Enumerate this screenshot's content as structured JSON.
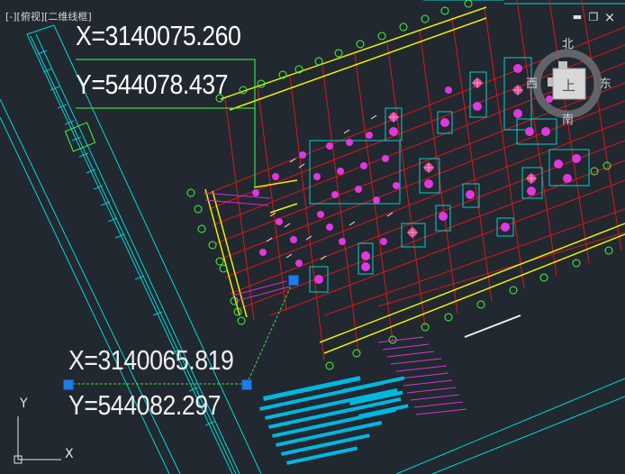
{
  "viewport": {
    "label": "[-][俯视][二维线框]"
  },
  "window_controls": {
    "close": "×",
    "restore": "❐",
    "minimize": "▬"
  },
  "coordinate_callouts": {
    "top": {
      "x_text": "X=3140075.260",
      "y_text": "Y=544078.437"
    },
    "bottom": {
      "x_text": "X=3140065.819",
      "y_text": "Y=544082.297"
    }
  },
  "viewcube": {
    "north": "北",
    "south": "南",
    "east": "东",
    "west": "西",
    "face": "上"
  },
  "ucs": {
    "x_label": "X",
    "y_label": "Y"
  },
  "colors": {
    "background": "#212830",
    "grid_red": "#e02020",
    "axis_yellow": "#f0f000",
    "axis_green": "#40ff40",
    "border_cyan": "#00e0e0",
    "column_magenta": "#e040e0",
    "grip_blue": "#1e7be8"
  }
}
